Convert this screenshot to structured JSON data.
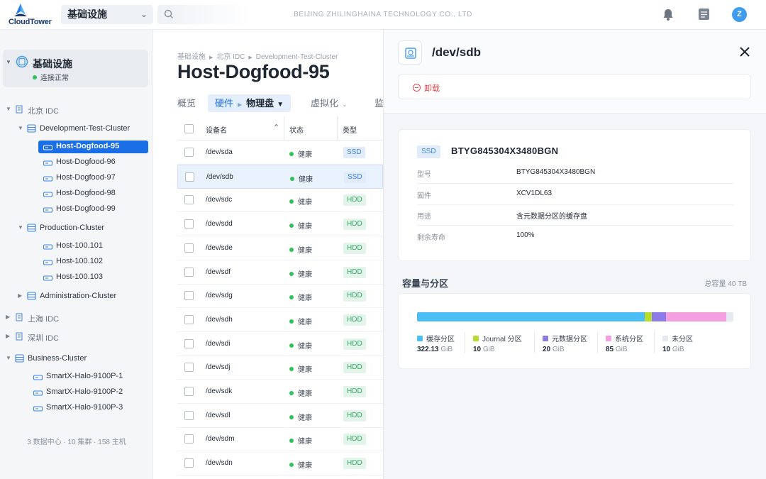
{
  "app": {
    "brand": "CloudTower",
    "company": "BEIJING ZHILINGHAINA TECHNOLOGY CO., LTD",
    "avatar_initial": "Z",
    "scope": "基础设施"
  },
  "colors": {
    "accent": "#1a6ee6",
    "healthy": "#2fc25b",
    "danger": "#e5484d"
  },
  "sidebar": {
    "root": {
      "title": "基础设施",
      "status": "连接正常"
    },
    "tree": [
      {
        "label": "北京 IDC",
        "type": "datacenter"
      },
      {
        "label": "Development-Test-Cluster",
        "type": "cluster"
      },
      {
        "label": "Host-Dogfood-95",
        "type": "host",
        "selected": true
      },
      {
        "label": "Host-Dogfood-96",
        "type": "host"
      },
      {
        "label": "Host-Dogfood-97",
        "type": "host"
      },
      {
        "label": "Host-Dogfood-98",
        "type": "host"
      },
      {
        "label": "Host-Dogfood-99",
        "type": "host"
      },
      {
        "label": "Production-Cluster",
        "type": "cluster"
      },
      {
        "label": "Host-100.101",
        "type": "host"
      },
      {
        "label": "Host-100.102",
        "type": "host"
      },
      {
        "label": "Host-100.103",
        "type": "host"
      },
      {
        "label": "Administration-Cluster",
        "type": "cluster"
      },
      {
        "label": "上海 IDC",
        "type": "datacenter"
      },
      {
        "label": "深圳 IDC",
        "type": "datacenter"
      },
      {
        "label": "Business-Cluster",
        "type": "cluster"
      },
      {
        "label": "SmartX-Halo-9100P-1",
        "type": "host"
      },
      {
        "label": "SmartX-Halo-9100P-2",
        "type": "host"
      },
      {
        "label": "SmartX-Halo-9100P-3",
        "type": "host"
      }
    ],
    "footer": "3 数据中心 · 10 集群 · 158 主机"
  },
  "main": {
    "breadcrumb": [
      "基础设施",
      "北京 IDC",
      "Development-Test-Cluster"
    ],
    "title": "Host-Dogfood-95",
    "tabs": {
      "overview": "概览",
      "hardware": "硬件",
      "physical_disk": "物理盘",
      "virtualization": "虚拟化",
      "monitor": "监"
    },
    "table": {
      "headers": {
        "name": "设备名",
        "state": "状态",
        "type": "类型"
      },
      "rows": [
        {
          "name": "/dev/sda",
          "state": "健康",
          "type": "SSD"
        },
        {
          "name": "/dev/sdb",
          "state": "健康",
          "type": "SSD",
          "selected": true
        },
        {
          "name": "/dev/sdc",
          "state": "健康",
          "type": "HDD"
        },
        {
          "name": "/dev/sdd",
          "state": "健康",
          "type": "HDD"
        },
        {
          "name": "/dev/sde",
          "state": "健康",
          "type": "HDD"
        },
        {
          "name": "/dev/sdf",
          "state": "健康",
          "type": "HDD"
        },
        {
          "name": "/dev/sdg",
          "state": "健康",
          "type": "HDD"
        },
        {
          "name": "/dev/sdh",
          "state": "健康",
          "type": "HDD"
        },
        {
          "name": "/dev/sdi",
          "state": "健康",
          "type": "HDD"
        },
        {
          "name": "/dev/sdj",
          "state": "健康",
          "type": "HDD"
        },
        {
          "name": "/dev/sdk",
          "state": "健康",
          "type": "HDD"
        },
        {
          "name": "/dev/sdl",
          "state": "健康",
          "type": "HDD"
        },
        {
          "name": "/dev/sdm",
          "state": "健康",
          "type": "HDD"
        },
        {
          "name": "/dev/sdn",
          "state": "健康",
          "type": "HDD"
        }
      ]
    }
  },
  "panel": {
    "title": "/dev/sdb",
    "unmount_label": "卸载",
    "disk_type": "SSD",
    "serial": "BTYG845304X3480BGN",
    "info": [
      {
        "key": "型号",
        "value": "BTYG845304X3480BGN"
      },
      {
        "key": "固件",
        "value": "XCV1DL63"
      },
      {
        "key": "用途",
        "value": "含元数据分区的缓存盘"
      },
      {
        "key": "剩余寿命",
        "value": "100%"
      }
    ],
    "capacity_title": "容量与分区",
    "total_capacity": "总容量 40 TB",
    "partitions": [
      {
        "label": "缓存分区",
        "value": "322.13",
        "unit": "GiB",
        "color": "#4bbef5"
      },
      {
        "label": "Journal 分区",
        "value": "10",
        "unit": "GiB",
        "color": "#b9dd2b"
      },
      {
        "label": "元数据分区",
        "value": "20",
        "unit": "GiB",
        "color": "#8c7ae6"
      },
      {
        "label": "系统分区",
        "value": "85",
        "unit": "GiB",
        "color": "#f59fe0"
      },
      {
        "label": "未分区",
        "value": "10",
        "unit": "GiB",
        "color": "#e6e9ef"
      }
    ]
  }
}
